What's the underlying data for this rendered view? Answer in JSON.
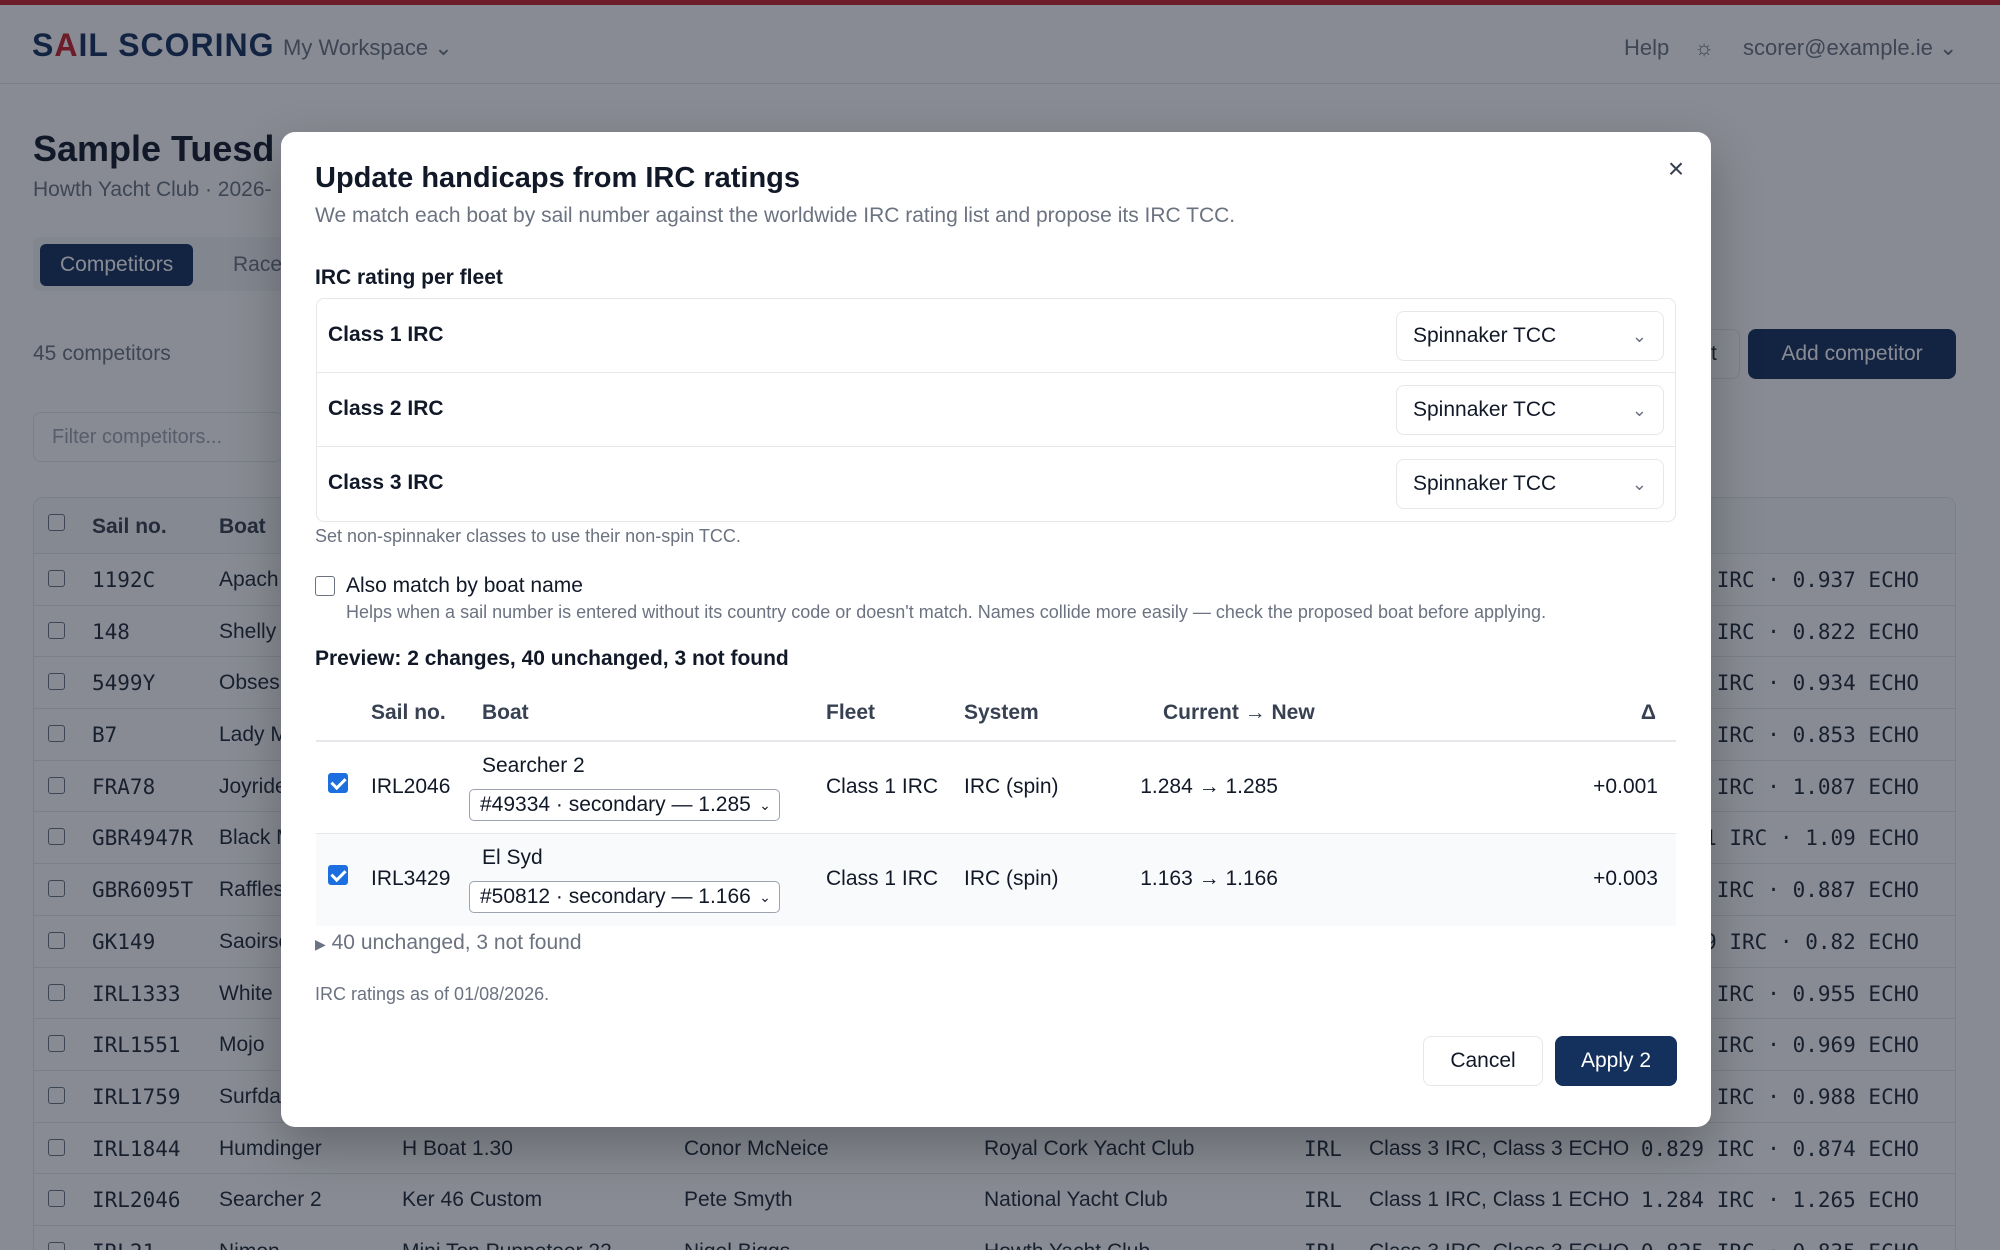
{
  "header": {
    "logo_a": "S",
    "logo_b": "A",
    "logo_c": "IL SCORING",
    "workspace": "My Workspace",
    "help": "Help",
    "user": "scorer@example.ie"
  },
  "event": {
    "title": "Sample Tuesd",
    "subtitle": "Howth Yacht Club · 2026-",
    "tab_competitors": "Competitors",
    "tab_races": "Race",
    "count": "45 competitors",
    "filter_placeholder": "Filter competitors...",
    "export_label": "t",
    "add_button": "Add competitor"
  },
  "bg_table": {
    "headers": {
      "sail": "Sail no.",
      "boat": "Boat",
      "rating": "g"
    },
    "rows": [
      {
        "sail": "1192C",
        "boat": "Apach",
        "rating": "5 IRC · 0.937 ECHO"
      },
      {
        "sail": "148",
        "boat": "Shelly",
        "rating": "4 IRC · 0.822 ECHO"
      },
      {
        "sail": "5499Y",
        "boat": "Obses",
        "rating": "4 IRC · 0.934 ECHO"
      },
      {
        "sail": "B7",
        "boat": "Lady M",
        "rating": "5 IRC · 0.853 ECHO"
      },
      {
        "sail": "FRA78",
        "boat": "Joyride",
        "rating": "5 IRC · 1.087 ECHO"
      },
      {
        "sail": "GBR4947R",
        "boat": "Black M",
        "rating": "1 IRC · 1.09 ECHO"
      },
      {
        "sail": "GBR6095T",
        "boat": "Raffles",
        "rating": "7 IRC · 0.887 ECHO"
      },
      {
        "sail": "GK149",
        "boat": "Saoirse",
        "rating": "9 IRC · 0.82 ECHO"
      },
      {
        "sail": "IRL1333",
        "boat": "White",
        "rating": "IRC · 0.955 ECHO"
      },
      {
        "sail": "IRL1551",
        "boat": "Mojo",
        "rating": "1 IRC · 0.969 ECHO"
      },
      {
        "sail": "IRL1759",
        "boat": "Surfda",
        "rating": "IRC · 0.988 ECHO"
      },
      {
        "sail": "IRL1844",
        "boat": "Humdinger",
        "design": "H Boat 1.30",
        "owner": "Conor McNeice",
        "club": "Royal Cork Yacht Club",
        "nat": "IRL",
        "fleets": "Class 3 IRC, Class 3 ECHO",
        "rating": "0.829 IRC · 0.874 ECHO"
      },
      {
        "sail": "IRL2046",
        "boat": "Searcher 2",
        "design": "Ker 46 Custom",
        "owner": "Pete Smyth",
        "club": "National Yacht Club",
        "nat": "IRL",
        "fleets": "Class 1 IRC, Class 1 ECHO",
        "rating": "1.284 IRC · 1.265 ECHO"
      },
      {
        "sail": "IRL21",
        "boat": "Nimon",
        "design": "Mini Ton Puppeteer 22",
        "owner": "Nigel Biggs",
        "club": "Howth Yacht Club",
        "nat": "IRL",
        "fleets": "Class 3 IRC, Class 3 ECHO",
        "rating": "0.825 IRC · 0.835 ECHO"
      }
    ]
  },
  "modal": {
    "title": "Update handicaps from IRC ratings",
    "description": "We match each boat by sail number against the worldwide IRC rating list and propose its IRC TCC.",
    "section_label": "IRC rating per fleet",
    "fleets": [
      {
        "name": "Class 1 IRC",
        "rating": "Spinnaker TCC"
      },
      {
        "name": "Class 2 IRC",
        "rating": "Spinnaker TCC"
      },
      {
        "name": "Class 3 IRC",
        "rating": "Spinnaker TCC"
      }
    ],
    "fleet_hint": "Set non-spinnaker classes to use their non-spin TCC.",
    "match_name_label": "Also match by boat name",
    "match_name_help": "Helps when a sail number is entered without its country code or doesn't match. Names collide more easily — check the proposed boat before applying.",
    "match_name_checked": false,
    "preview_label": "Preview: 2 changes, 40 unchanged, 3 not found",
    "preview_headers": {
      "sail": "Sail no.",
      "boat": "Boat",
      "fleet": "Fleet",
      "system": "System",
      "current_new": "Current → New",
      "delta": "Δ"
    },
    "preview_rows": [
      {
        "checked": true,
        "sail": "IRL2046",
        "boat": "Searcher 2",
        "match": "#49334 · secondary — 1.285",
        "fleet": "Class 1 IRC",
        "system": "IRC (spin)",
        "change": "1.284 → 1.285",
        "delta": "+0.001"
      },
      {
        "checked": true,
        "sail": "IRL3429",
        "boat": "El Syd",
        "match": "#50812 · secondary — 1.166",
        "fleet": "Class 1 IRC",
        "system": "IRC (spin)",
        "change": "1.163 → 1.166",
        "delta": "+0.003"
      }
    ],
    "summary": "40 unchanged, 3 not found",
    "as_of": "IRC ratings as of 01/08/2026.",
    "cancel": "Cancel",
    "apply": "Apply 2"
  }
}
